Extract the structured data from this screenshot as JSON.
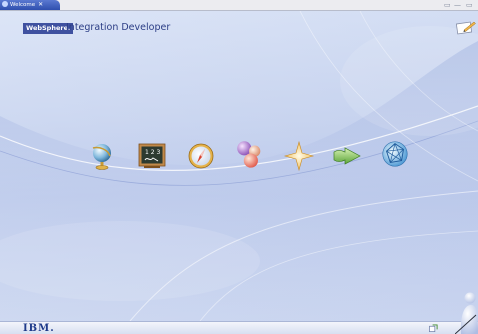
{
  "tab": {
    "label": "Welcome",
    "close": "✕"
  },
  "window_controls": {
    "restore": "▭",
    "minimize": "—",
    "maximize": "▭"
  },
  "header": {
    "brand": "WebSphere.",
    "title": "Integration Developer"
  },
  "footer": {
    "logo": "IBM."
  },
  "icons": [
    "globe-icon",
    "chalkboard-icon",
    "compass-icon",
    "spheres-icon",
    "sparkle-star-icon",
    "arrow-icon",
    "web-sphere-icon"
  ],
  "colors": {
    "accent": "#3f51a0",
    "tab": "#2f4fae",
    "background": "#c8d4ef"
  }
}
